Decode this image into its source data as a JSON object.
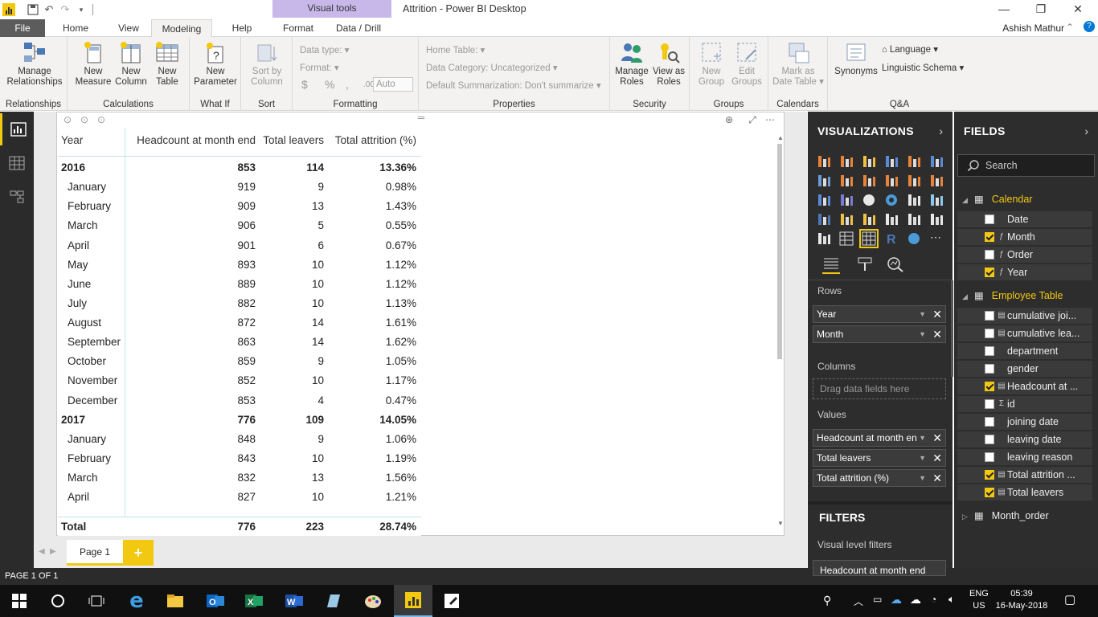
{
  "window": {
    "title": "Attrition - Power BI Desktop",
    "contextual_band": "Visual tools",
    "user": "Ashish Mathur"
  },
  "tabs": [
    "File",
    "Home",
    "View",
    "Modeling",
    "Help",
    "Format",
    "Data / Drill"
  ],
  "ribbon": {
    "relationships": {
      "btn": "Manage\nRelationships",
      "group": "Relationships"
    },
    "calculations": {
      "new_measure": "New\nMeasure",
      "new_column": "New\nColumn",
      "new_table": "New\nTable",
      "group": "Calculations"
    },
    "whatif": {
      "new_parameter": "New\nParameter",
      "group": "What If"
    },
    "sort": {
      "sort_by_column": "Sort by\nColumn",
      "group": "Sort"
    },
    "formatting": {
      "data_type": "Data type:",
      "format": "Format:",
      "currency": "$",
      "percent": "%",
      "comma": ",",
      "decimals": ".00",
      "auto": "Auto",
      "group": "Formatting"
    },
    "properties": {
      "home_table": "Home Table:",
      "data_category": "Data Category: Uncategorized",
      "default_summarization": "Default Summarization: Don't summarize",
      "group": "Properties"
    },
    "security": {
      "manage_roles": "Manage\nRoles",
      "view_as_roles": "View as\nRoles",
      "group": "Security"
    },
    "groups": {
      "new_group": "New\nGroup",
      "edit_groups": "Edit\nGroups",
      "group": "Groups"
    },
    "calendars": {
      "mark_as_date_table": "Mark as\nDate Table",
      "group": "Calendars"
    },
    "qa": {
      "synonyms": "Synonyms",
      "language": "Language",
      "linguistic_schema": "Linguistic Schema",
      "group": "Q&A"
    }
  },
  "matrix": {
    "headers": [
      "Year",
      "Headcount at month end",
      "Total leavers",
      "Total attrition (%)"
    ],
    "rows": [
      {
        "label": "2016",
        "headcount": "853",
        "leavers": "114",
        "attrition": "13.36%",
        "level": 0
      },
      {
        "label": "January",
        "headcount": "919",
        "leavers": "9",
        "attrition": "0.98%",
        "level": 1
      },
      {
        "label": "February",
        "headcount": "909",
        "leavers": "13",
        "attrition": "1.43%",
        "level": 1
      },
      {
        "label": "March",
        "headcount": "906",
        "leavers": "5",
        "attrition": "0.55%",
        "level": 1
      },
      {
        "label": "April",
        "headcount": "901",
        "leavers": "6",
        "attrition": "0.67%",
        "level": 1
      },
      {
        "label": "May",
        "headcount": "893",
        "leavers": "10",
        "attrition": "1.12%",
        "level": 1
      },
      {
        "label": "June",
        "headcount": "889",
        "leavers": "10",
        "attrition": "1.12%",
        "level": 1
      },
      {
        "label": "July",
        "headcount": "882",
        "leavers": "10",
        "attrition": "1.13%",
        "level": 1
      },
      {
        "label": "August",
        "headcount": "872",
        "leavers": "14",
        "attrition": "1.61%",
        "level": 1
      },
      {
        "label": "September",
        "headcount": "863",
        "leavers": "14",
        "attrition": "1.62%",
        "level": 1
      },
      {
        "label": "October",
        "headcount": "859",
        "leavers": "9",
        "attrition": "1.05%",
        "level": 1
      },
      {
        "label": "November",
        "headcount": "852",
        "leavers": "10",
        "attrition": "1.17%",
        "level": 1
      },
      {
        "label": "December",
        "headcount": "853",
        "leavers": "4",
        "attrition": "0.47%",
        "level": 1
      },
      {
        "label": "2017",
        "headcount": "776",
        "leavers": "109",
        "attrition": "14.05%",
        "level": 0
      },
      {
        "label": "January",
        "headcount": "848",
        "leavers": "9",
        "attrition": "1.06%",
        "level": 1
      },
      {
        "label": "February",
        "headcount": "843",
        "leavers": "10",
        "attrition": "1.19%",
        "level": 1
      },
      {
        "label": "March",
        "headcount": "832",
        "leavers": "13",
        "attrition": "1.56%",
        "level": 1
      },
      {
        "label": "April",
        "headcount": "827",
        "leavers": "10",
        "attrition": "1.21%",
        "level": 1
      }
    ],
    "total": {
      "label": "Total",
      "headcount": "776",
      "leavers": "223",
      "attrition": "28.74%"
    }
  },
  "pages": {
    "current": "Page 1",
    "add": "+",
    "status": "PAGE 1 OF 1"
  },
  "visualizations": {
    "title": "VISUALIZATIONS",
    "rows_label": "Rows",
    "rows": [
      "Year",
      "Month"
    ],
    "columns_label": "Columns",
    "columns_placeholder": "Drag data fields here",
    "values_label": "Values",
    "values": [
      "Headcount at month en",
      "Total leavers",
      "Total attrition (%)"
    ],
    "filters_title": "FILTERS",
    "visual_level_filters": "Visual level filters",
    "filter_item": "Headcount at month end"
  },
  "fields": {
    "title": "FIELDS",
    "search_placeholder": "Search",
    "tables": [
      {
        "name": "Calendar",
        "expanded": true,
        "fields": [
          {
            "name": "Date",
            "checked": false,
            "type": ""
          },
          {
            "name": "Month",
            "checked": true,
            "type": "fx"
          },
          {
            "name": "Order",
            "checked": false,
            "type": "fx"
          },
          {
            "name": "Year",
            "checked": true,
            "type": "fx"
          }
        ]
      },
      {
        "name": "Employee Table",
        "expanded": true,
        "fields": [
          {
            "name": "cumulative joi...",
            "checked": false,
            "type": "calc"
          },
          {
            "name": "cumulative lea...",
            "checked": false,
            "type": "calc"
          },
          {
            "name": "department",
            "checked": false,
            "type": ""
          },
          {
            "name": "gender",
            "checked": false,
            "type": ""
          },
          {
            "name": "Headcount at ...",
            "checked": true,
            "type": "calc"
          },
          {
            "name": "id",
            "checked": false,
            "type": "sigma"
          },
          {
            "name": "joining date",
            "checked": false,
            "type": ""
          },
          {
            "name": "leaving date",
            "checked": false,
            "type": ""
          },
          {
            "name": "leaving reason",
            "checked": false,
            "type": ""
          },
          {
            "name": "Total attrition ...",
            "checked": true,
            "type": "calc"
          },
          {
            "name": "Total leavers",
            "checked": true,
            "type": "calc"
          }
        ]
      },
      {
        "name": "Month_order",
        "expanded": false,
        "fields": []
      }
    ]
  },
  "taskbar": {
    "language": "ENG",
    "region": "US",
    "time": "05:39",
    "date": "16-May-2018"
  },
  "colors": {
    "accent": "#f2c811",
    "pane_bg": "#2d2d2d",
    "visual_tools": "#c8b8ea",
    "file_tab": "#5c5c5c"
  }
}
